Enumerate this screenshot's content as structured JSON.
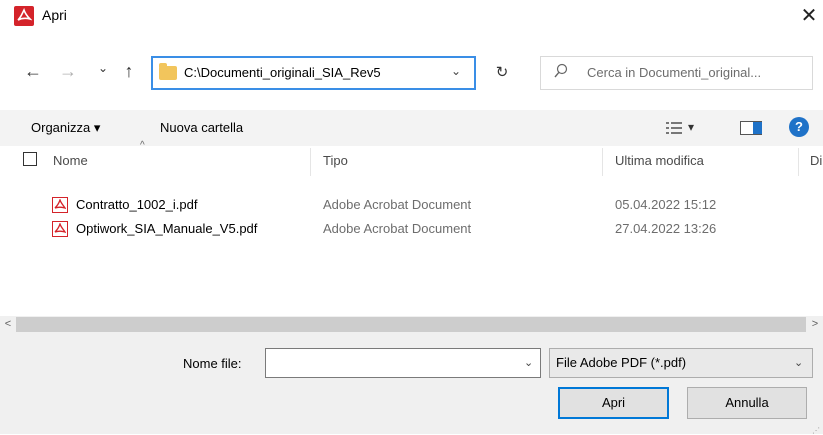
{
  "window": {
    "title": "Apri",
    "close_symbol": "✕"
  },
  "nav": {
    "back": "←",
    "forward": "→",
    "recent": "⌄",
    "up": "↑",
    "refresh": "↻"
  },
  "address": {
    "path": "C:\\Documenti_originali_SIA_Rev5",
    "chevron": "⌄"
  },
  "search": {
    "placeholder": "Cerca in Documenti_original..."
  },
  "toolbar": {
    "organize": "Organizza ▾",
    "new_folder": "Nuova cartella",
    "view_chevron": "▾",
    "help": "?"
  },
  "columns": {
    "name": "Nome",
    "type": "Tipo",
    "modified": "Ultima modifica",
    "size": "Di"
  },
  "files": [
    {
      "name": "Contratto_1002_i.pdf",
      "type": "Adobe Acrobat Document",
      "modified": "05.04.2022 15:12"
    },
    {
      "name": "Optiwork_SIA_Manuale_V5.pdf",
      "type": "Adobe Acrobat Document",
      "modified": "27.04.2022 13:26"
    }
  ],
  "scroll": {
    "left": "<",
    "right": ">"
  },
  "filename": {
    "label": "Nome file:",
    "value": "",
    "chevron": "⌄"
  },
  "filetype": {
    "selected": "File Adobe PDF (*.pdf)",
    "chevron": "⌄"
  },
  "buttons": {
    "open": "Apri",
    "cancel": "Annulla"
  },
  "colors": {
    "accent": "#0078d7",
    "acrobat_red": "#d4232a",
    "folder": "#f2c55c"
  }
}
